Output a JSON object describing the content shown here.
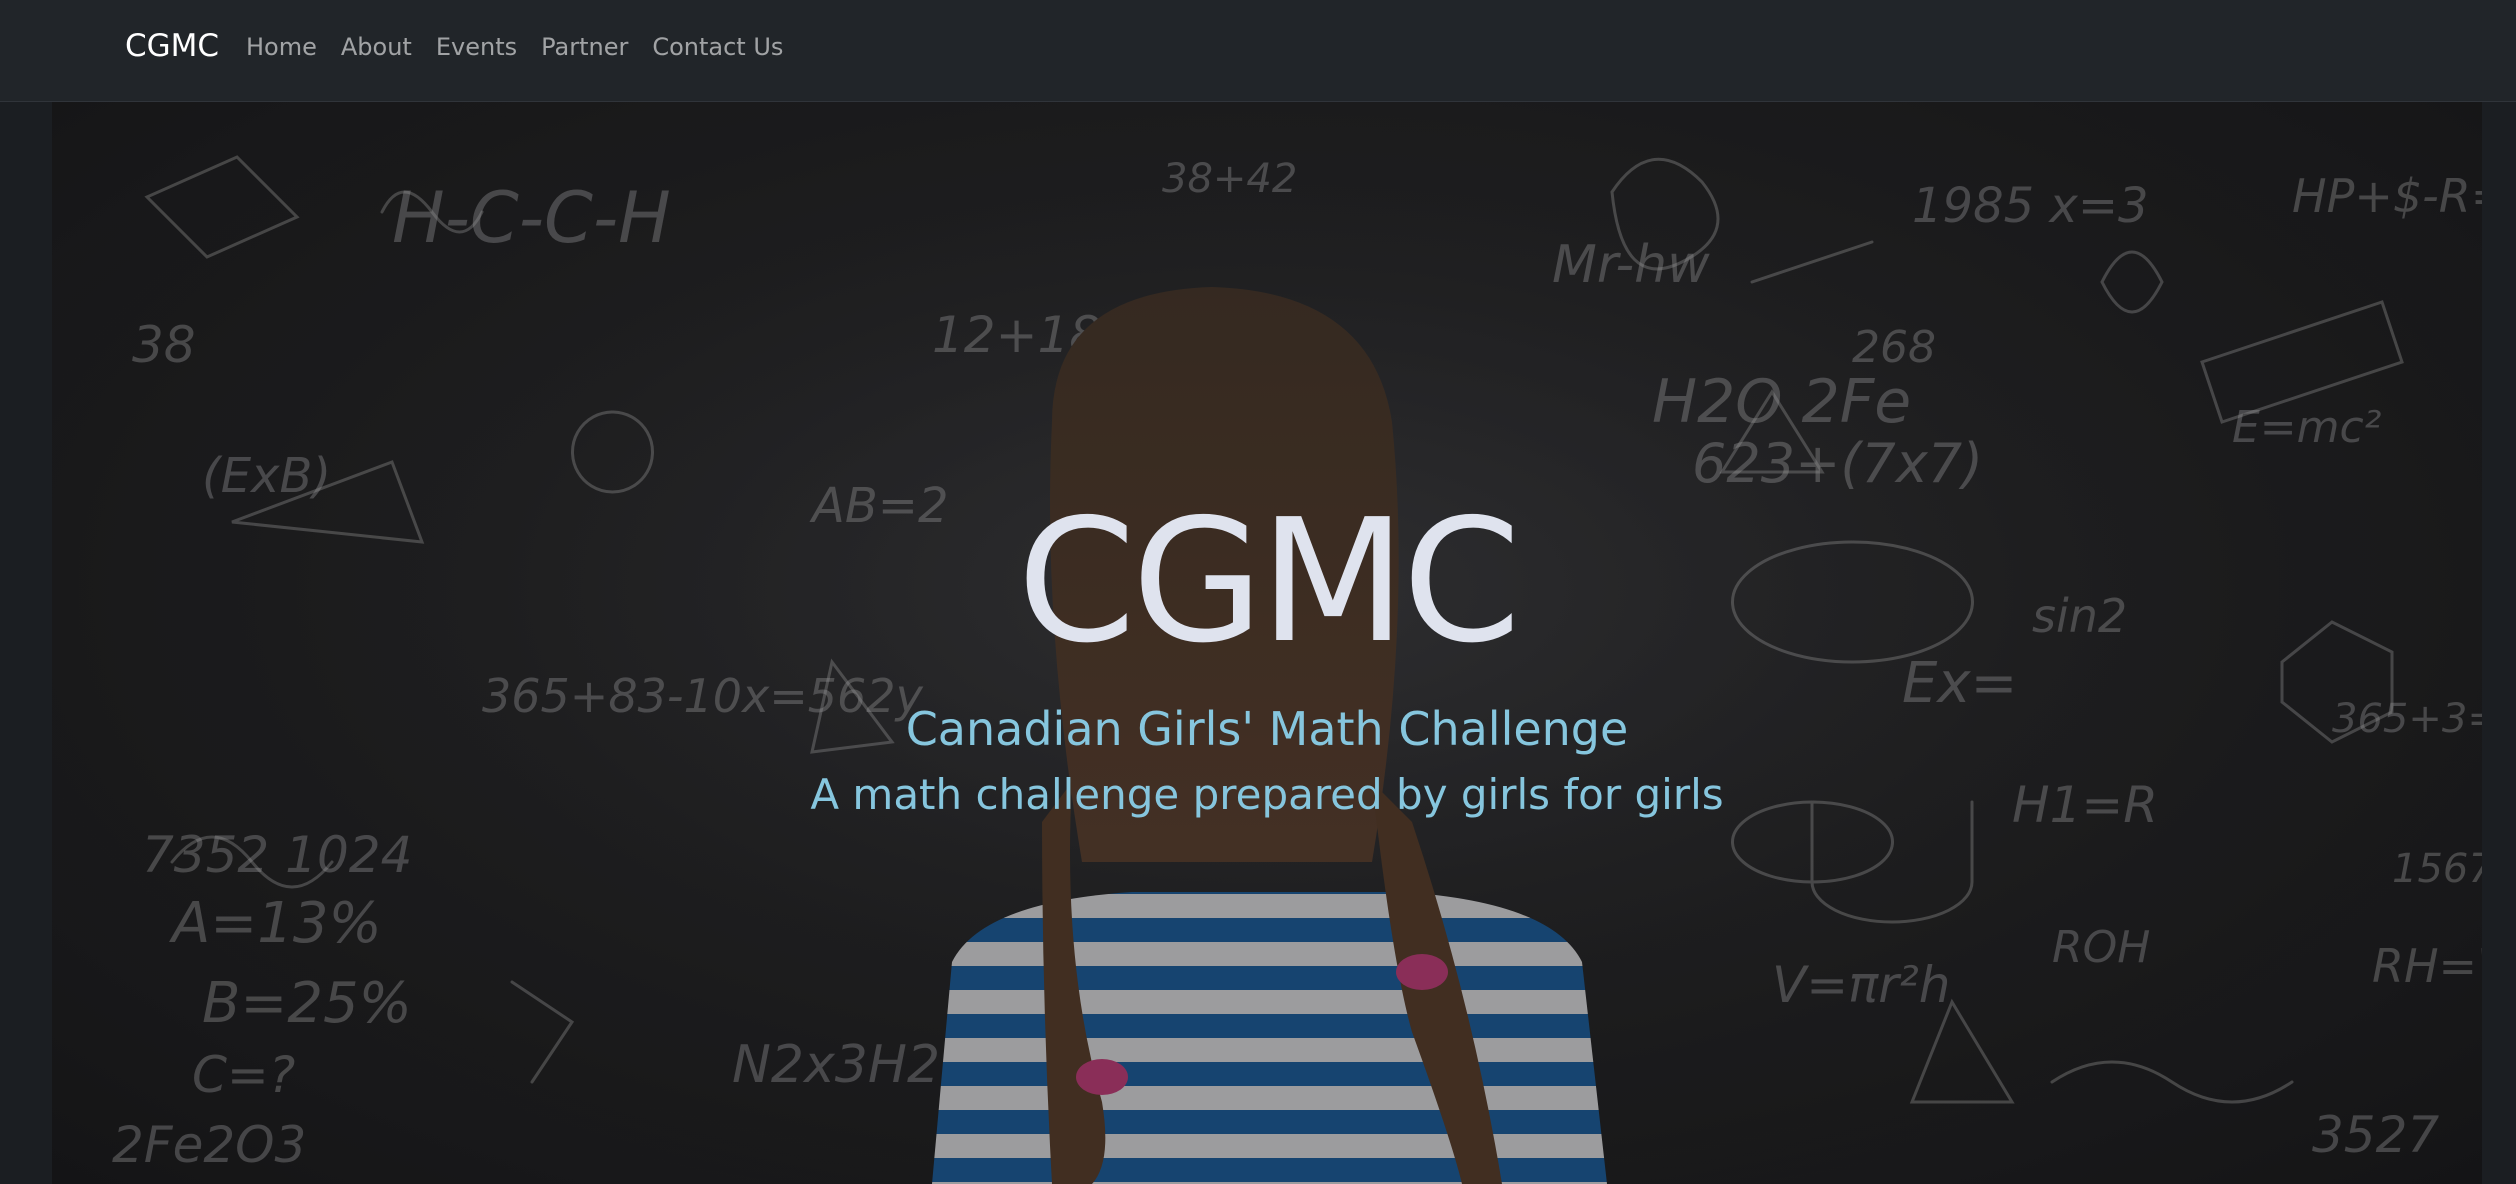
{
  "navbar": {
    "brand": "CGMC",
    "links": [
      "Home",
      "About",
      "Events",
      "Partner",
      "Contact Us"
    ]
  },
  "hero": {
    "title": "CGMC",
    "subtitle": "Canadian Girls' Math Challenge",
    "tagline": "A math challenge prepared by girls for girls",
    "image": "girl-facing-chalkboard-with-math-formulas"
  },
  "colors": {
    "navbar_bg": "#212529",
    "title": "#dfe3ee",
    "subtitle": "#86c6de"
  }
}
